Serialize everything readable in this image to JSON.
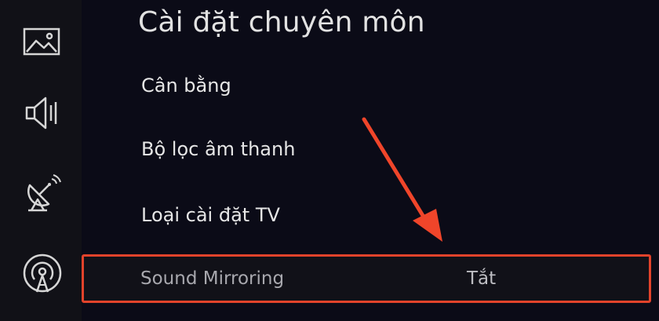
{
  "sidebar": {
    "icons": [
      "picture-icon",
      "speaker-icon",
      "satellite-dish-icon",
      "broadcast-antenna-icon"
    ]
  },
  "header": {
    "title": "Cài đặt chuyên môn"
  },
  "menu": {
    "items": [
      {
        "label": "Cân bằng"
      },
      {
        "label": "Bộ lọc âm thanh"
      },
      {
        "label": "Loại cài đặt TV"
      }
    ],
    "selected": {
      "label": "Sound Mirroring",
      "value": "Tắt"
    }
  },
  "colors": {
    "background": "#0b0b17",
    "highlight_border": "#e2432b",
    "arrow": "#f0452a"
  }
}
